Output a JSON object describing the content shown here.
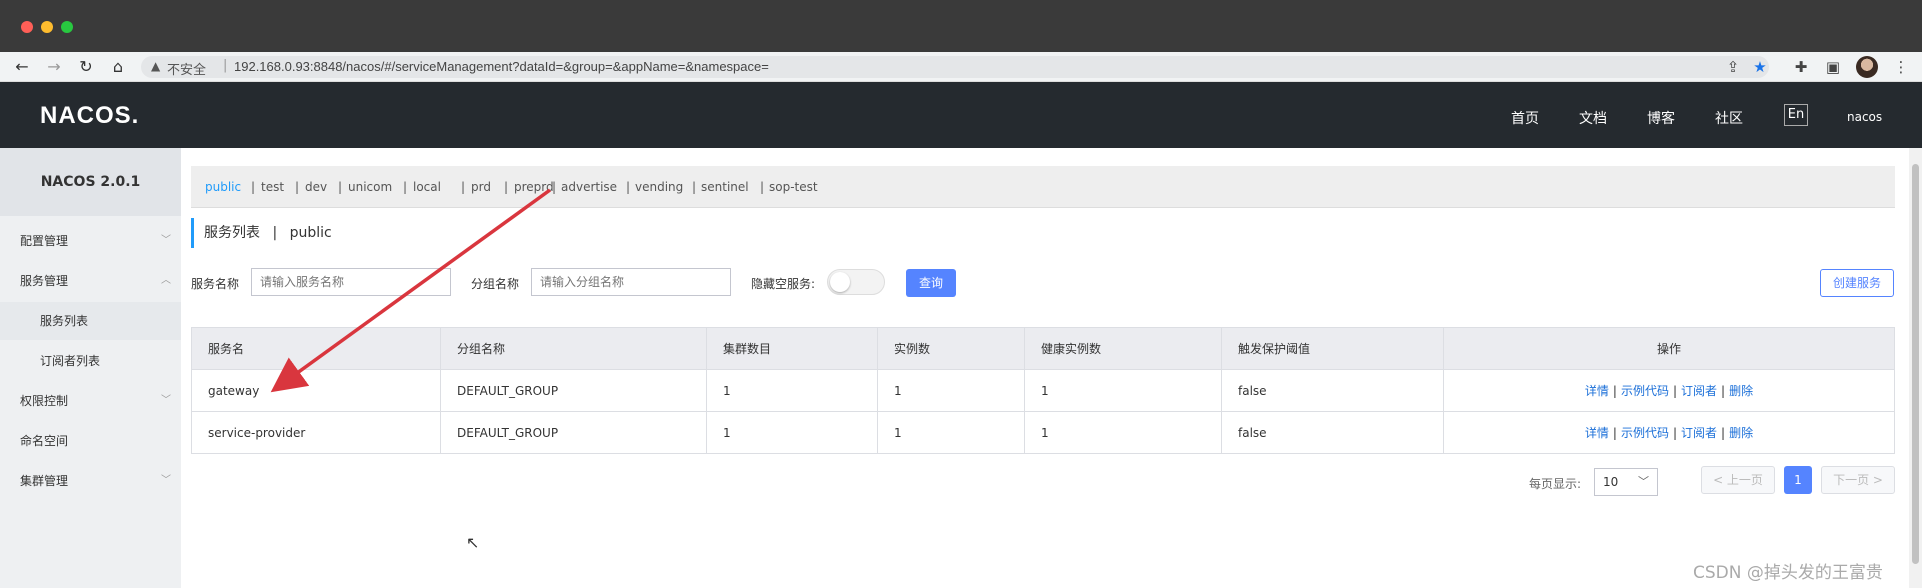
{
  "browser": {
    "insecure_label": "不安全",
    "separator": "|",
    "url": "192.168.0.93:8848/nacos/#/serviceManagement?dataId=&group=&appName=&namespace=",
    "traffic_colors": [
      "#ff5f57",
      "#febc2e",
      "#28c840"
    ]
  },
  "header": {
    "logo": "NACOS.",
    "nav": [
      "首页",
      "文档",
      "博客",
      "社区"
    ],
    "lang": "En",
    "user": "nacos"
  },
  "sidebar": {
    "title": "NACOS 2.0.1",
    "items": [
      {
        "label": "配置管理",
        "expandable": true,
        "open": false
      },
      {
        "label": "服务管理",
        "expandable": true,
        "open": true
      },
      {
        "label": "服务列表",
        "sub": true,
        "active": true
      },
      {
        "label": "订阅者列表",
        "sub": true
      },
      {
        "label": "权限控制",
        "expandable": true,
        "open": false
      },
      {
        "label": "命名空间"
      },
      {
        "label": "集群管理",
        "expandable": true,
        "open": false
      }
    ]
  },
  "namespaces": {
    "items": [
      "public",
      "test",
      "dev",
      "unicom",
      "local",
      "prd",
      "preprd",
      "advertise",
      "vending",
      "sentinel",
      "sop-test"
    ],
    "active": "public",
    "separator": "|"
  },
  "page": {
    "title": "服务列表",
    "separator": "|",
    "namespace": "public"
  },
  "filters": {
    "service_name_label": "服务名称",
    "service_name_placeholder": "请输入服务名称",
    "group_name_label": "分组名称",
    "group_name_placeholder": "请输入分组名称",
    "hide_empty_label": "隐藏空服务:",
    "hide_empty_on": false,
    "query_button": "查询",
    "create_button": "创建服务"
  },
  "table": {
    "columns": [
      "服务名",
      "分组名称",
      "集群数目",
      "实例数",
      "健康实例数",
      "触发保护阈值",
      "操作"
    ],
    "rows": [
      [
        "gateway",
        "DEFAULT_GROUP",
        "1",
        "1",
        "1",
        "false"
      ],
      [
        "service-provider",
        "DEFAULT_GROUP",
        "1",
        "1",
        "1",
        "false"
      ]
    ],
    "actions": [
      "详情",
      "示例代码",
      "订阅者",
      "删除"
    ],
    "action_separator": "|"
  },
  "pager": {
    "page_size_label": "每页显示:",
    "page_size": "10",
    "prev_label": "< 上一页",
    "next_label": "下一页 >",
    "current_page": "1"
  },
  "watermark": "CSDN @掉头发的王富贵",
  "annotation_color": "#d9363e"
}
